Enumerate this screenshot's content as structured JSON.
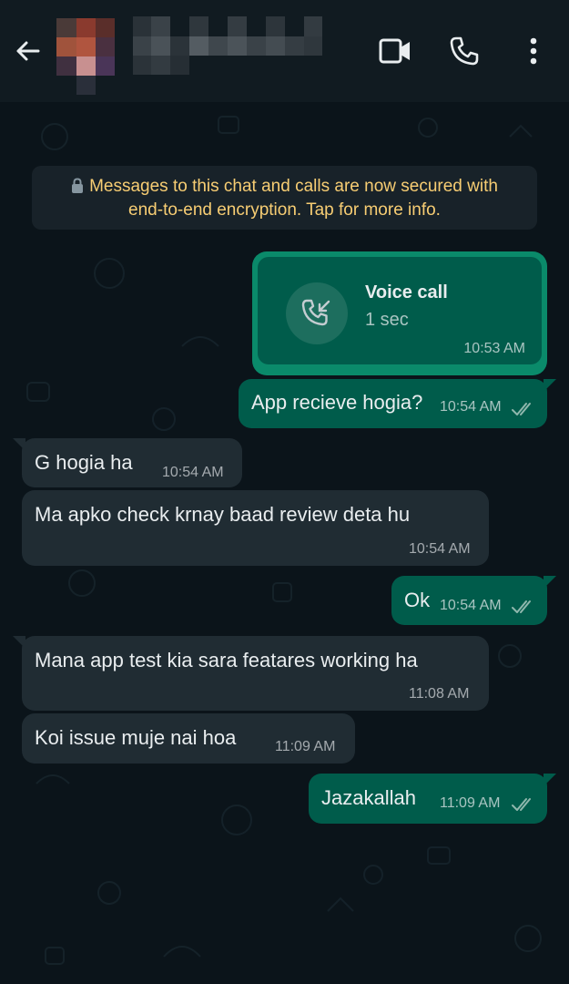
{
  "header": {
    "back_icon": "arrow-left-icon",
    "contact_name": "",
    "video_call_icon": "video-camera-icon",
    "voice_call_icon": "phone-icon",
    "menu_icon": "more-vertical-icon"
  },
  "encryption_notice": {
    "line1": "Messages to this chat and calls are now secured with",
    "line2": "end-to-end encryption. Tap for more info.",
    "icon": "lock-icon",
    "color": "#f7cd73"
  },
  "voice_call": {
    "title": "Voice call",
    "duration": "1 sec",
    "time": "10:53 AM",
    "icon": "incoming-call-icon"
  },
  "messages": [
    {
      "direction": "out",
      "text": "App recieve hogia?",
      "time": "10:54 AM",
      "status": "read"
    },
    {
      "direction": "in",
      "text": "G hogia ha",
      "time": "10:54 AM"
    },
    {
      "direction": "in",
      "text": "Ma apko check krnay baad review deta hu",
      "time": "10:54 AM"
    },
    {
      "direction": "out",
      "text": "Ok",
      "time": "10:54 AM",
      "status": "read"
    },
    {
      "direction": "in",
      "text": "Mana app test kia sara featares working ha",
      "time": "11:08 AM"
    },
    {
      "direction": "in",
      "text": "Koi issue muje nai hoa",
      "time": "11:09 AM"
    },
    {
      "direction": "out",
      "text": "Jazakallah",
      "time": "11:09 AM",
      "status": "read"
    }
  ],
  "colors": {
    "background": "#0b141a",
    "header": "#111b21",
    "outgoing_bubble": "#005c4b",
    "incoming_bubble": "#202c33",
    "text": "#e9edef"
  }
}
